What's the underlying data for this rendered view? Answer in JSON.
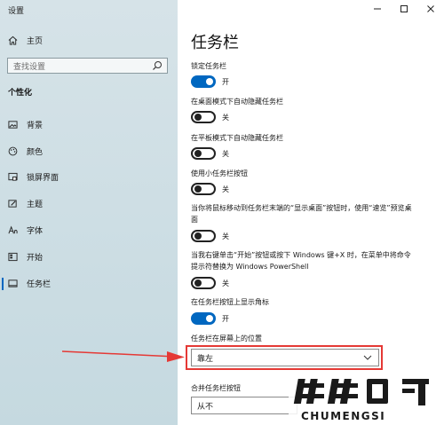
{
  "window": {
    "title": "设置"
  },
  "sidebar": {
    "home_label": "主页",
    "search_placeholder": "查找设置",
    "section_label": "个性化",
    "items": [
      {
        "label": "背景",
        "icon": "image-icon"
      },
      {
        "label": "颜色",
        "icon": "palette-icon"
      },
      {
        "label": "锁屏界面",
        "icon": "lockscreen-icon"
      },
      {
        "label": "主题",
        "icon": "brush-icon"
      },
      {
        "label": "字体",
        "icon": "font-icon"
      },
      {
        "label": "开始",
        "icon": "start-icon"
      },
      {
        "label": "任务栏",
        "icon": "taskbar-icon"
      }
    ]
  },
  "page": {
    "title": "任务栏",
    "settings": [
      {
        "label": "锁定任务栏",
        "state": "开",
        "on": true
      },
      {
        "label": "在桌面模式下自动隐藏任务栏",
        "state": "关",
        "on": false
      },
      {
        "label": "在平板模式下自动隐藏任务栏",
        "state": "关",
        "on": false
      },
      {
        "label": "使用小任务栏按钮",
        "state": "关",
        "on": false
      },
      {
        "label_line1": "当你将鼠标移动到任务栏末端的“显示桌面”按钮时，使用“速览”预览桌",
        "label_line2": "面",
        "state": "关",
        "on": false
      },
      {
        "label_line1": "当我右键单击“开始”按钮或按下 Windows 键+X 时，在菜单中将命令",
        "label_line2": "提示符替换为 Windows PowerShell",
        "state": "关",
        "on": false
      },
      {
        "label": "在任务栏按钮上显示角标",
        "state": "开",
        "on": true
      }
    ],
    "position": {
      "label": "任务栏在屏幕上的位置",
      "value": "靠左"
    },
    "combine": {
      "label": "合并任务栏按钮",
      "value": "从不"
    }
  },
  "watermark": {
    "text": "CHUMENGSI"
  },
  "colors": {
    "accent": "#0067c0",
    "highlight": "#e53935"
  }
}
